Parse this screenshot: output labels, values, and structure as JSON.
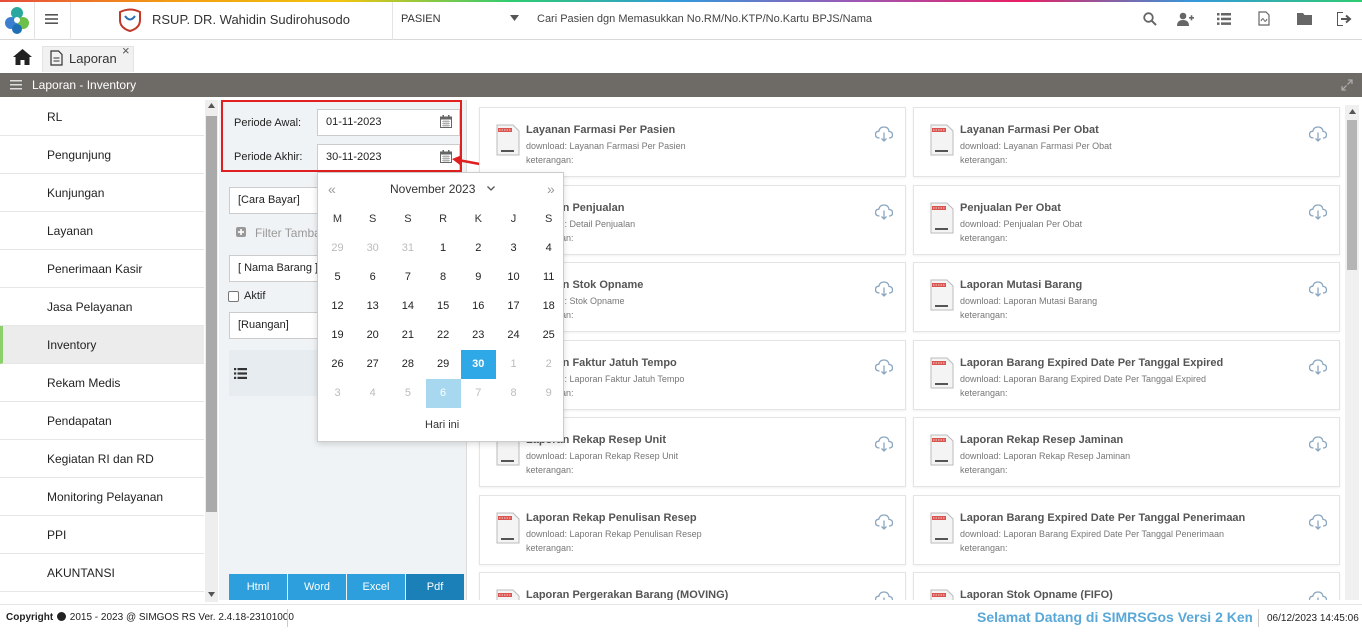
{
  "header": {
    "hospital_name": "RSUP. DR. Wahidin Sudirohusodo",
    "patient_select": "PASIEN",
    "patient_search_placeholder": "Cari Pasien dgn Memasukkan No.RM/No.KTP/No.Kartu BPJS/Nama"
  },
  "tabs": [
    {
      "label": "Laporan",
      "close": "×"
    }
  ],
  "page_title": "Laporan - Inventory",
  "sidebar": {
    "items": [
      {
        "label": "RL"
      },
      {
        "label": "Pengunjung"
      },
      {
        "label": "Kunjungan"
      },
      {
        "label": "Layanan"
      },
      {
        "label": "Penerimaan Kasir"
      },
      {
        "label": "Jasa Pelayanan"
      },
      {
        "label": "Inventory"
      },
      {
        "label": "Rekam Medis"
      },
      {
        "label": "Pendapatan"
      },
      {
        "label": "Kegiatan RI dan RD"
      },
      {
        "label": "Monitoring Pelayanan"
      },
      {
        "label": "PPI"
      },
      {
        "label": "AKUNTANSI"
      }
    ]
  },
  "filter": {
    "periode_awal_label": "Periode Awal:",
    "periode_awal_value": "01-11-2023",
    "periode_akhir_label": "Periode Akhir:",
    "periode_akhir_value": "30-11-2023",
    "cara_bayar": "[Cara Bayar]",
    "filter_tambahan": "Filter Tamba",
    "nama_barang": "[ Nama Barang ]",
    "aktif_label": "Aktif",
    "ruangan": "[Ruangan]",
    "export": [
      "Html",
      "Word",
      "Excel",
      "Pdf"
    ]
  },
  "calendar": {
    "prev": "«",
    "next": "»",
    "month_label": "November 2023",
    "weekdays": [
      "M",
      "S",
      "S",
      "R",
      "K",
      "J",
      "S"
    ],
    "weeks": [
      [
        "29",
        "30",
        "31",
        "1",
        "2",
        "3",
        "4"
      ],
      [
        "5",
        "6",
        "7",
        "8",
        "9",
        "10",
        "11"
      ],
      [
        "12",
        "13",
        "14",
        "15",
        "16",
        "17",
        "18"
      ],
      [
        "19",
        "20",
        "21",
        "22",
        "23",
        "24",
        "25"
      ],
      [
        "26",
        "27",
        "28",
        "29",
        "30",
        "1",
        "2"
      ],
      [
        "3",
        "4",
        "5",
        "6",
        "7",
        "8",
        "9"
      ]
    ],
    "selected_date": "30",
    "today_label": "Hari ini"
  },
  "cards": [
    {
      "title": "Layanan Farmasi Per Pasien",
      "download": "download: Layanan Farmasi Per Pasien",
      "keterangan": "keterangan:"
    },
    {
      "title": "Layanan Farmasi Per Obat",
      "download": "download: Layanan Farmasi Per Obat",
      "keterangan": "keterangan:"
    },
    {
      "title": "Laporan Penjualan",
      "download": "download: Detail Penjualan",
      "keterangan": "keterangan:"
    },
    {
      "title": "Penjualan Per Obat",
      "download": "download: Penjualan Per Obat",
      "keterangan": "keterangan:"
    },
    {
      "title": "Laporan Stok Opname",
      "download": "download: Stok Opname",
      "keterangan": "keterangan:"
    },
    {
      "title": "Laporan Mutasi Barang",
      "download": "download: Laporan Mutasi Barang",
      "keterangan": "keterangan:"
    },
    {
      "title": "Laporan Faktur Jatuh Tempo",
      "download": "download: Laporan Faktur Jatuh Tempo",
      "keterangan": "keterangan:"
    },
    {
      "title": "Laporan Barang Expired Date Per Tanggal Expired",
      "download": "download: Laporan Barang Expired Date Per Tanggal Expired",
      "keterangan": "keterangan:"
    },
    {
      "title": "Laporan Rekap Resep Unit",
      "download": "download: Laporan Rekap Resep Unit",
      "keterangan": "keterangan:"
    },
    {
      "title": "Laporan Rekap Resep Jaminan",
      "download": "download: Laporan Rekap Resep Jaminan",
      "keterangan": "keterangan:"
    },
    {
      "title": "Laporan Rekap Penulisan Resep",
      "download": "download: Laporan Rekap Penulisan Resep",
      "keterangan": "keterangan:"
    },
    {
      "title": "Laporan Barang Expired Date Per Tanggal Penerimaan",
      "download": "download: Laporan Barang Expired Date Per Tanggal Penerimaan",
      "keterangan": "keterangan:"
    },
    {
      "title": "Laporan Pergerakan Barang (MOVING)",
      "download": "",
      "keterangan": ""
    },
    {
      "title": "Laporan Stok Opname (FIFO)",
      "download": "",
      "keterangan": ""
    }
  ],
  "footer": {
    "copyright": "Copyright",
    "copyright_rest": "2015 - 2023 @ SIMGOS RS Ver. 2.4.18-23101000",
    "welcome": "Selamat Datang di SIMRSGos Versi 2 Kem",
    "datetime": "06/12/2023 14:45:06"
  },
  "colors": {
    "accent": "#2ea8e6",
    "title_bar": "#6e6a66",
    "highlight": "#e02020",
    "active_marker": "#8bd06b"
  }
}
